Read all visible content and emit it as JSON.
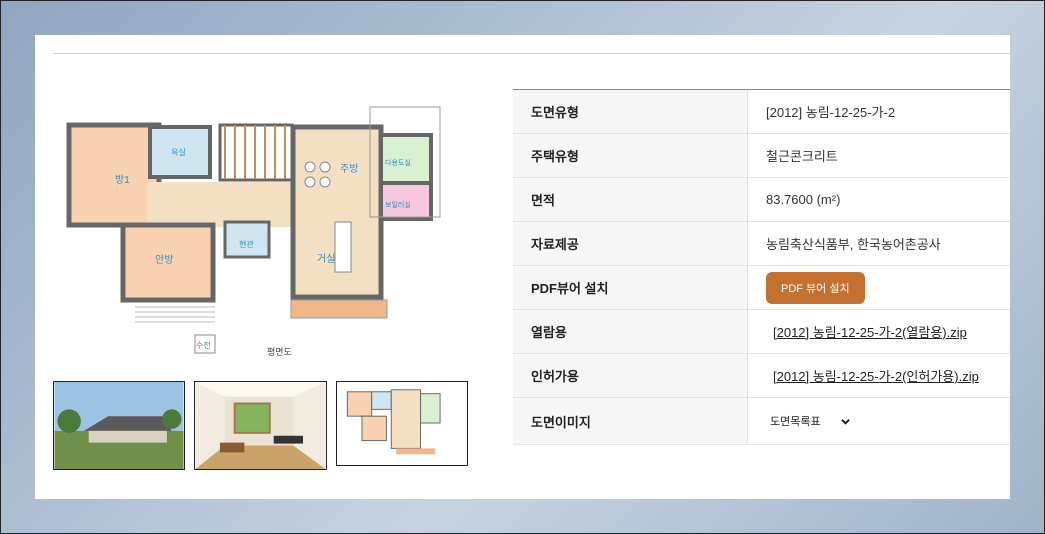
{
  "plan": {
    "rooms": {
      "room1": "방1",
      "bath": "욕실",
      "kitchen": "주방",
      "laundry": "다용도실",
      "boiler": "보일러실",
      "inner_room": "안방",
      "closet": "현관",
      "living": "거실"
    },
    "entry_label": "수전",
    "caption": "평면도"
  },
  "thumbnails": [
    "exterior-render",
    "interior-render",
    "floor-plan"
  ],
  "table": {
    "rows": [
      {
        "key": "도면유형",
        "value": "[2012] 농림-12-25-가-2"
      },
      {
        "key": "주택유형",
        "value": "철근콘크리트"
      },
      {
        "key": "면적",
        "value": "83.7600 (m²)"
      },
      {
        "key": "자료제공",
        "value": "농림축산식품부, 한국농어촌공사"
      },
      {
        "key": "PDF뷰어 설치",
        "value": "PDF 뷰어 설치"
      },
      {
        "key": "열람용",
        "value": "[2012] 농림-12-25-가-2(열람용).zip"
      },
      {
        "key": "인허가용",
        "value": "[2012] 농림-12-25-가-2(인허가용).zip"
      },
      {
        "key": "도면이미지",
        "value": "도면목록표"
      }
    ]
  }
}
